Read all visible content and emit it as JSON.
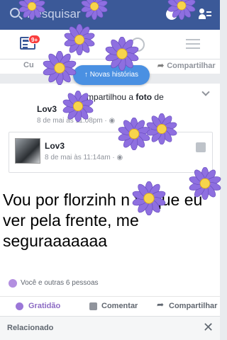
{
  "search": {
    "placeholder": "Pesquisar"
  },
  "tabs": {
    "notifications_badge": "9+"
  },
  "previous_post": {
    "like_label": "Cu",
    "share_label": "Compartilhar"
  },
  "new_stories": {
    "label": "↑ Novas histórias"
  },
  "post": {
    "shared_text": "compartilhou a",
    "shared_object": "foto",
    "shared_suffix": "de",
    "author": "Lov3",
    "time": "8 de mai às 11:08pm · ◉",
    "inner_author": "Lov3",
    "inner_time": "8 de mai às 11:14am · ◉",
    "meme_text": "Vou por florzinh    n tu   que eu ver pela frente, me seguraaaaaaa"
  },
  "reactions": {
    "summary": "Você e outras 6 pessoas"
  },
  "actions": {
    "reaction": "Gratidão",
    "comment": "Comentar",
    "share": "Compartilhar"
  },
  "related": {
    "label": "Relacionado",
    "close": "✕"
  },
  "colors": {
    "brand": "#3b5998",
    "accent_purple": "#8c6bc4",
    "flower_petal": "#8e6fe0",
    "flower_center": "#f7d44c"
  }
}
